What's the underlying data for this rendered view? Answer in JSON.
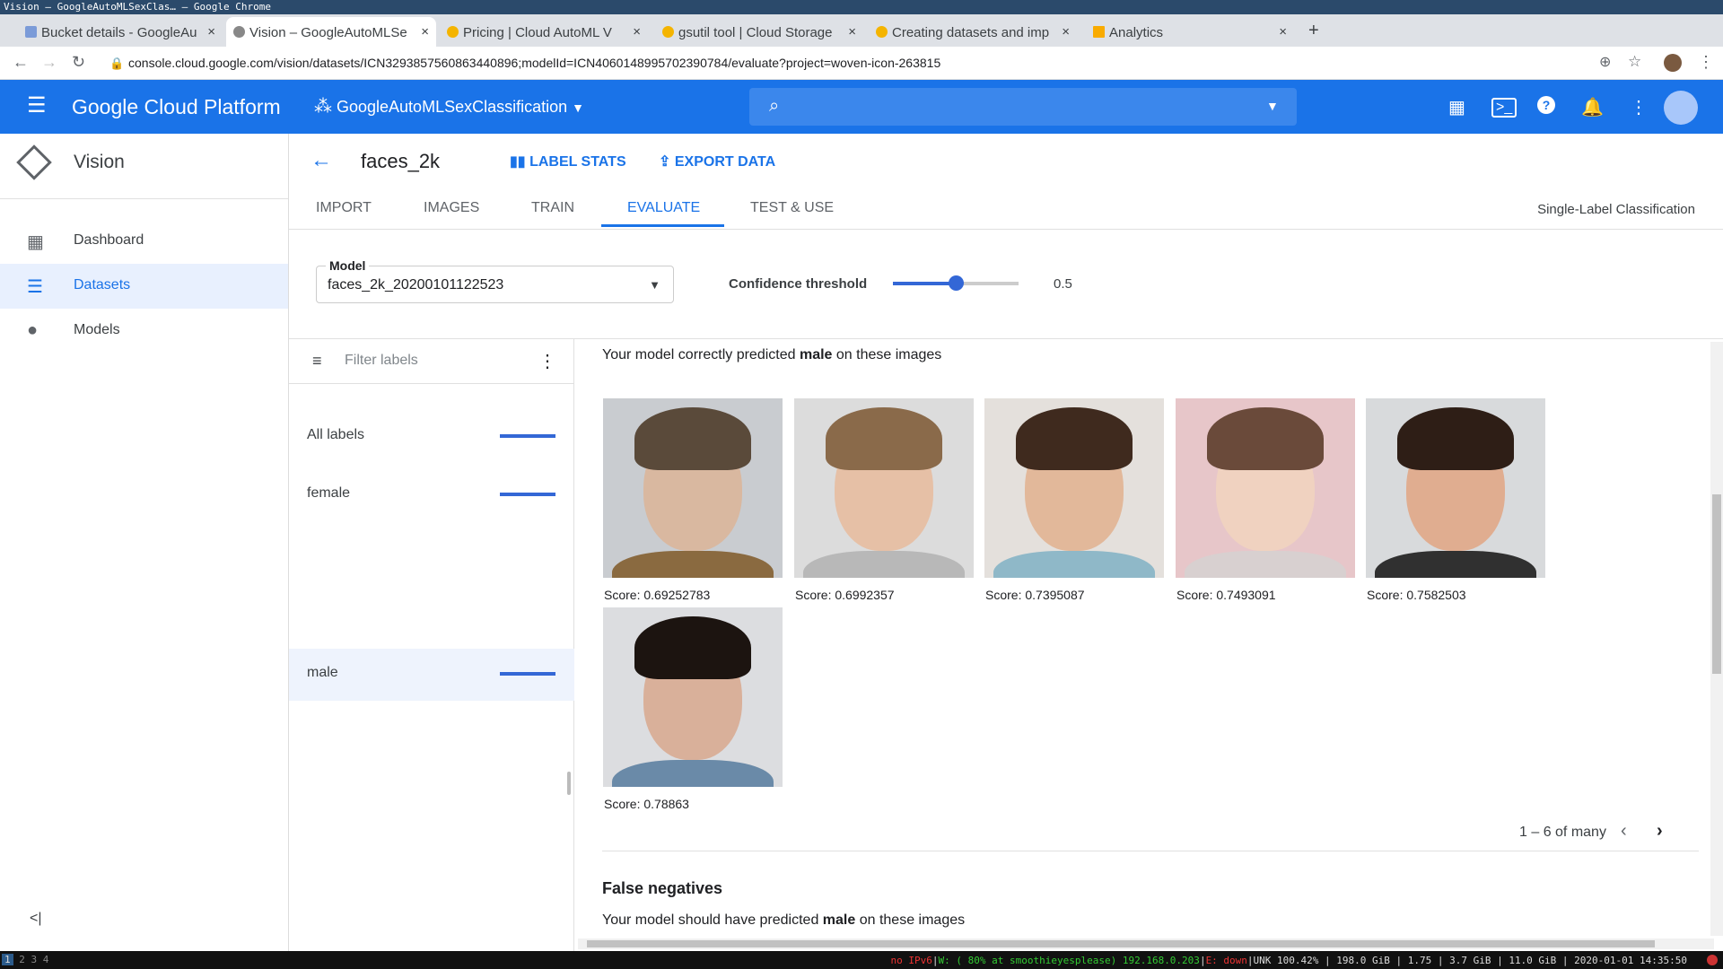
{
  "window_title": "Vision – GoogleAutoMLSexClas… – Google Chrome",
  "tabs": [
    {
      "label": "Bucket details - GoogleAu"
    },
    {
      "label": "Vision – GoogleAutoMLSe"
    },
    {
      "label": "Pricing | Cloud AutoML V"
    },
    {
      "label": "gsutil tool | Cloud Storage"
    },
    {
      "label": "Creating datasets and imp"
    },
    {
      "label": "Analytics"
    }
  ],
  "url": "console.cloud.google.com/vision/datasets/ICN3293857560863440896;modelId=ICN4060148995702390784/evaluate?project=woven-icon-263815",
  "header": {
    "brand": "Google Cloud Platform",
    "project": "GoogleAutoMLSexClassification"
  },
  "sidebar": {
    "product": "Vision",
    "items": [
      {
        "label": "Dashboard",
        "icon": "dashboard-icon"
      },
      {
        "label": "Datasets",
        "icon": "list-icon"
      },
      {
        "label": "Models",
        "icon": "lightbulb-icon"
      }
    ]
  },
  "dataset": {
    "title": "faces_2k",
    "label_stats": "LABEL STATS",
    "export_data": "EXPORT DATA"
  },
  "main_tabs": [
    "IMPORT",
    "IMAGES",
    "TRAIN",
    "EVALUATE",
    "TEST & USE"
  ],
  "active_tab": "EVALUATE",
  "classification_type": "Single-Label Classification",
  "model": {
    "label": "Model",
    "value": "faces_2k_20200101122523"
  },
  "confidence": {
    "label": "Confidence threshold",
    "value": "0.5",
    "fraction": 0.5
  },
  "filter": {
    "placeholder": "Filter labels"
  },
  "labels": [
    {
      "name": "All labels"
    },
    {
      "name": "female"
    },
    {
      "name": "male"
    }
  ],
  "selected_label": "male",
  "true_positives": {
    "prefix": "Your model correctly predicted ",
    "label": "male",
    "suffix": " on these images",
    "images": [
      {
        "score": "Score: 0.69252783",
        "colors": [
          "#c9ccd0",
          "#d9b8a0",
          "#5a4a3a",
          "#8a6a40"
        ]
      },
      {
        "score": "Score: 0.6992357",
        "colors": [
          "#dcdcdc",
          "#e6c0a6",
          "#8a6a4a",
          "#b8b8b8"
        ]
      },
      {
        "score": "Score: 0.7395087",
        "colors": [
          "#e4e0dc",
          "#e2b89a",
          "#3f2a1e",
          "#8fb8c8"
        ]
      },
      {
        "score": "Score: 0.7493091",
        "colors": [
          "#e7c6c9",
          "#f0d2c0",
          "#6a4a3a",
          "#d8d0d0"
        ]
      },
      {
        "score": "Score: 0.7582503",
        "colors": [
          "#d8dadc",
          "#e0ad90",
          "#2e1e16",
          "#303030"
        ]
      },
      {
        "score": "Score: 0.78863",
        "colors": [
          "#dcdde0",
          "#d9b09a",
          "#1c1410",
          "#6a8aa8"
        ]
      }
    ]
  },
  "pagination": "1 – 6 of many",
  "false_negatives": {
    "title": "False negatives",
    "prefix": "Your model should have predicted ",
    "label": "male",
    "suffix": " on these images"
  },
  "taskbar": {
    "workspaces": [
      "1",
      "2",
      "3",
      "4"
    ],
    "status_red1": "no IPv6",
    "status_green": "W: ( 80% at smoothieyesplease) 192.168.0.203",
    "status_red2": "E: down",
    "status_rest": "UNK 100.42% | 198.0 GiB | 1.75 | 3.7 GiB | 11.0 GiB | 2020-01-01 14:35:50"
  }
}
